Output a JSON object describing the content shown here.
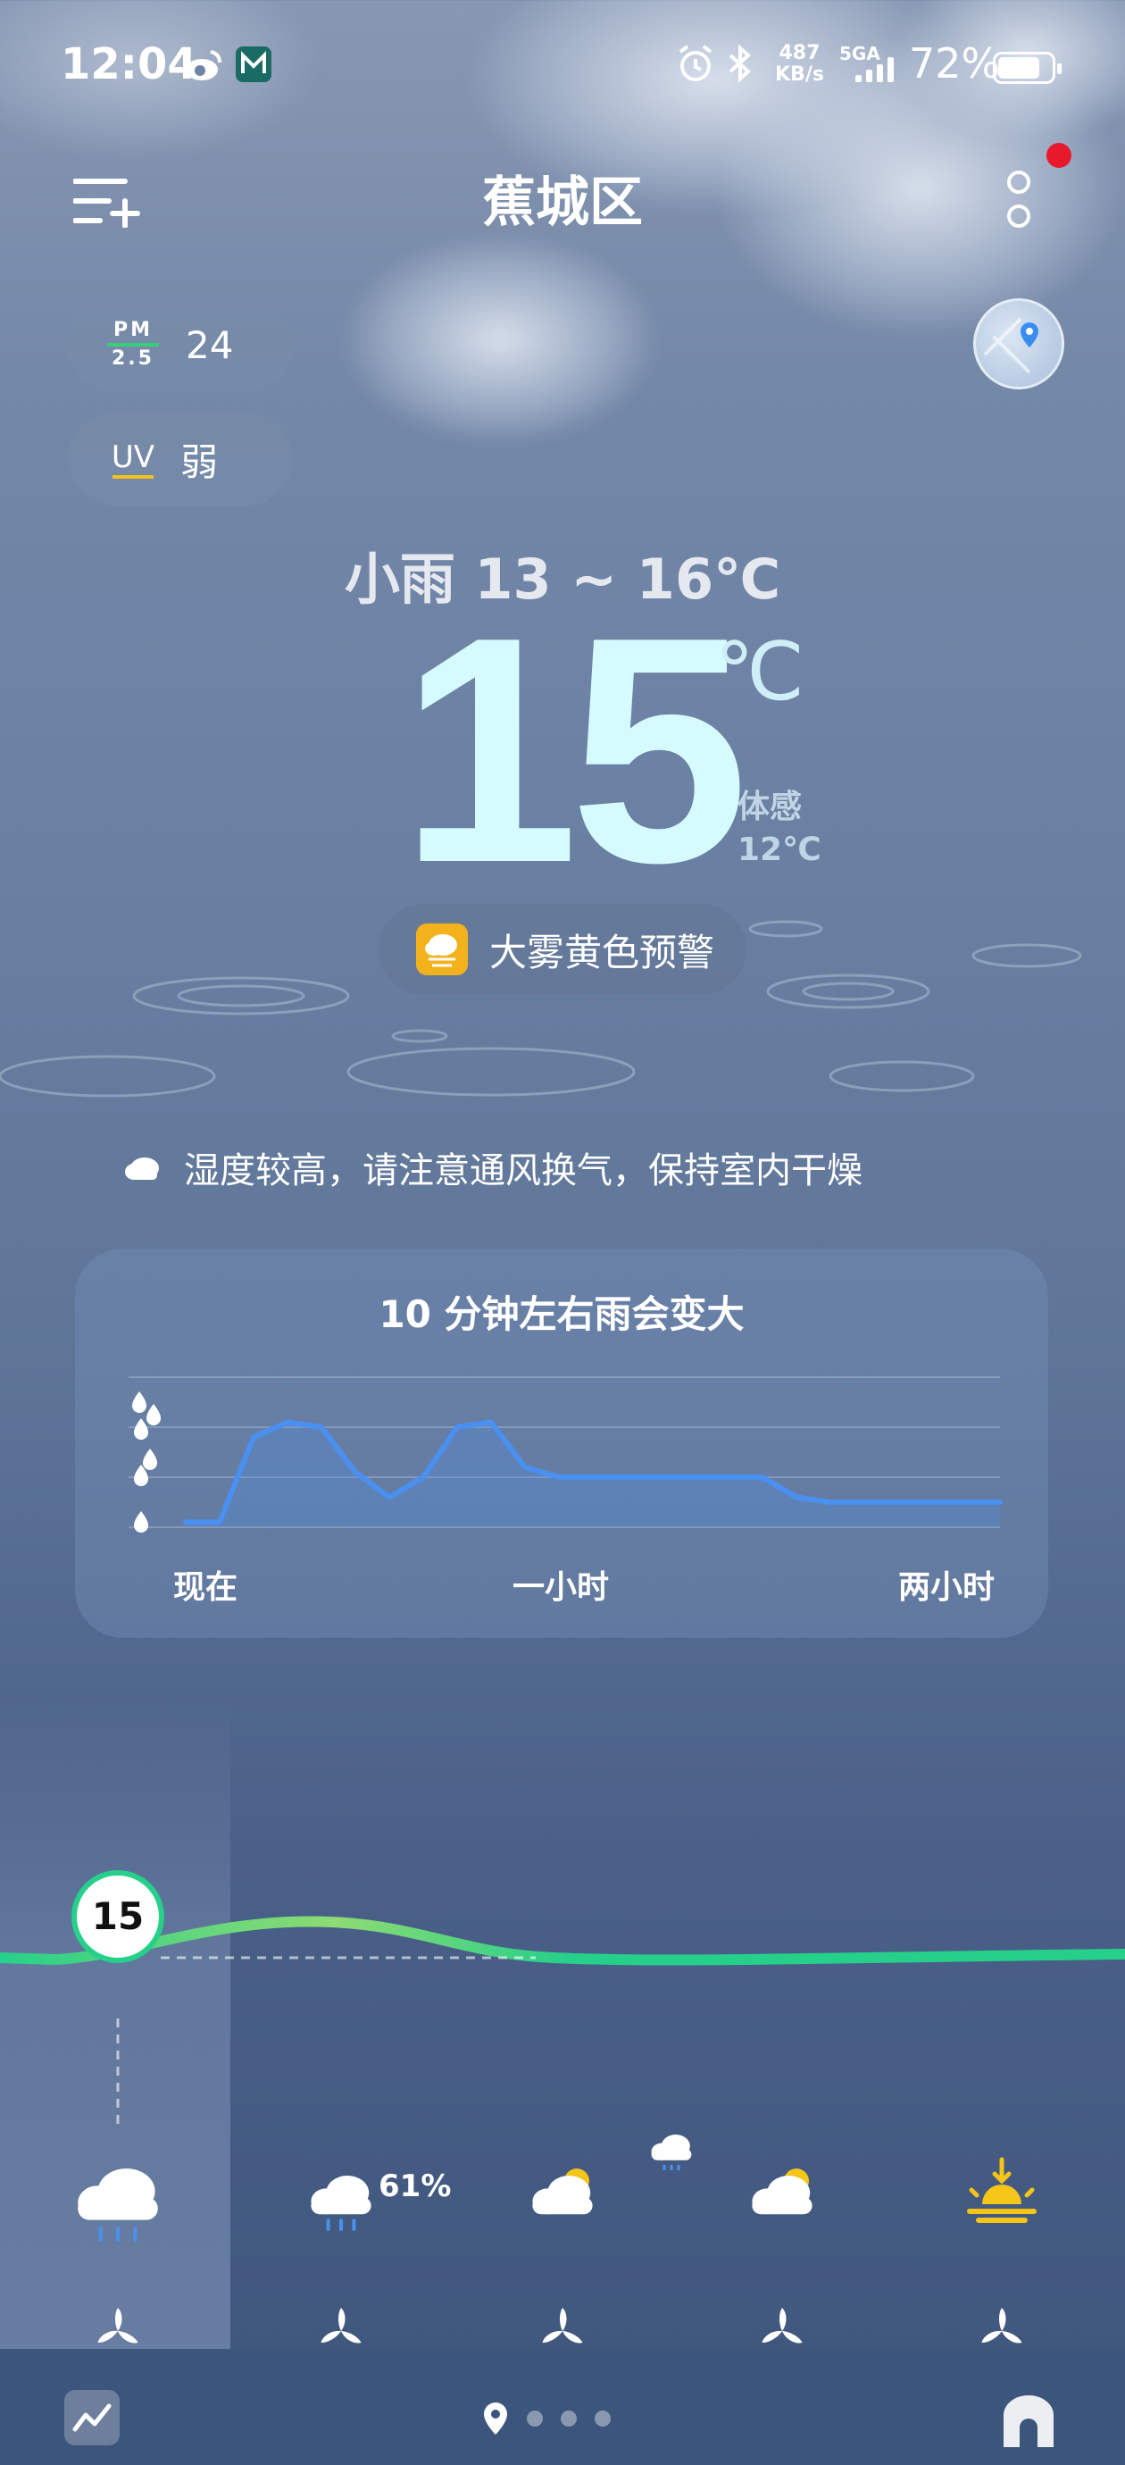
{
  "status_bar": {
    "time": "12:04",
    "net_speed_value": "487",
    "net_speed_unit": "KB/s",
    "network": "5GA",
    "battery": "72%"
  },
  "header": {
    "city": "蕉城区",
    "menu_icon": "add-city-icon",
    "more_icon": "more-icon"
  },
  "badges": {
    "pm25_label_top": "PM",
    "pm25_label_bottom": "2.5",
    "pm25_value": "24",
    "uv_label": "UV",
    "uv_value": "弱"
  },
  "current": {
    "condition_range": "小雨  13 ~ 16℃",
    "temperature": "15",
    "unit": "℃",
    "feels_label": "体感",
    "feels_value": "12℃"
  },
  "warning": {
    "text": "大雾黄色预警",
    "color": "#f3b21b"
  },
  "tip": {
    "text": "湿度较高，请注意通风换气，保持室内干燥"
  },
  "rain_card": {
    "title": "10 分钟左右雨会变大",
    "x_labels": [
      "现在",
      "一小时",
      "两小时"
    ]
  },
  "chart_data": {
    "type": "area",
    "title": "10 分钟左右雨会变大",
    "x_labels": [
      "现在",
      "一小时",
      "两小时"
    ],
    "y_levels": [
      "light",
      "moderate",
      "heavy"
    ],
    "ylim": [
      0,
      3
    ],
    "x": [
      0,
      5,
      10,
      15,
      20,
      25,
      30,
      35,
      40,
      45,
      50,
      55,
      60,
      65,
      70,
      75,
      80,
      85,
      90,
      95,
      100,
      105,
      110,
      115,
      120
    ],
    "values": [
      0.1,
      0.1,
      1.8,
      2.1,
      2.0,
      1.1,
      0.6,
      1.0,
      2.0,
      2.1,
      1.2,
      1.0,
      1.0,
      1.0,
      1.0,
      1.0,
      1.0,
      1.0,
      0.6,
      0.5,
      0.5,
      0.5,
      0.5,
      0.5,
      0.5
    ],
    "color": "#4a90f0",
    "grid": true
  },
  "hourly": {
    "current_temp": "15",
    "items": [
      {
        "icon": "rain-icon",
        "precip": ""
      },
      {
        "icon": "rain-icon",
        "precip": "61%"
      },
      {
        "icon": "partly-cloudy-icon",
        "precip": ""
      },
      {
        "icon": "partly-cloudy-icon",
        "precip": ""
      },
      {
        "icon": "sunset-icon",
        "precip": ""
      }
    ],
    "line_color": "#27d08a"
  },
  "page_indicator": {
    "pages": 4,
    "active": 0
  }
}
